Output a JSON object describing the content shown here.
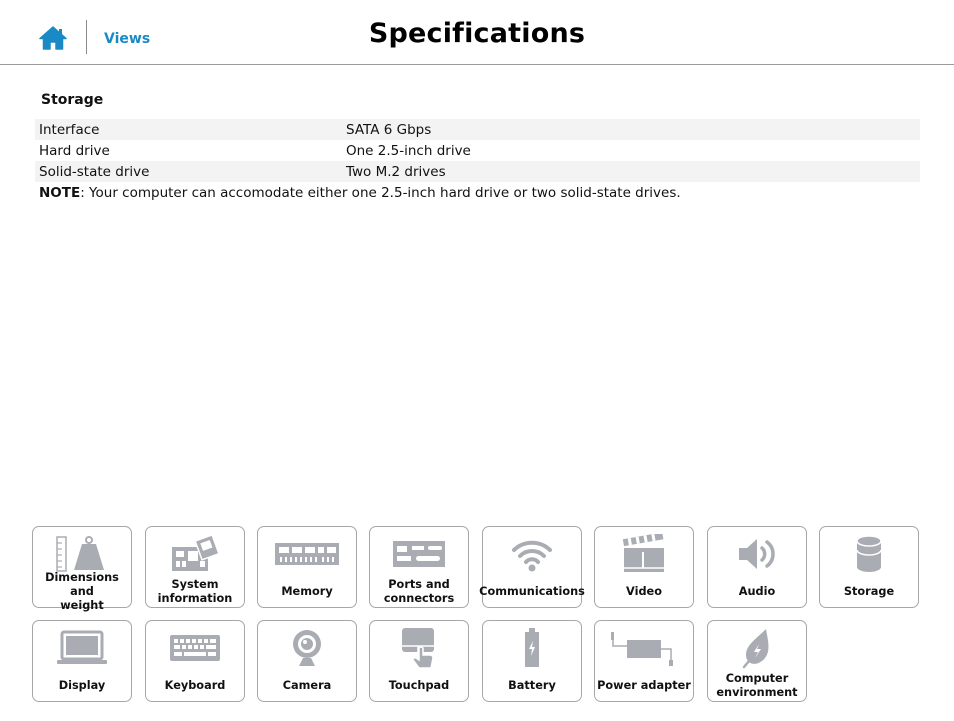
{
  "header": {
    "home_icon": "home-icon",
    "views_label": "Views",
    "title": "Specifications"
  },
  "section": {
    "title": "Storage",
    "rows": [
      {
        "label": "Interface",
        "value": "SATA 6 Gbps"
      },
      {
        "label": "Hard drive",
        "value": "One 2.5-inch drive"
      },
      {
        "label": "Solid-state drive",
        "value": "Two M.2 drives"
      }
    ],
    "note_bold": "NOTE",
    "note_text": ": Your computer can accomodate either one 2.5-inch hard drive or two solid-state drives."
  },
  "tiles": [
    {
      "line1": "Dimensions and",
      "line2": "weight",
      "icon": "ruler-weight-icon"
    },
    {
      "line1": "System",
      "line2": "information",
      "icon": "motherboard-icon"
    },
    {
      "line1": "Memory",
      "line2": "",
      "icon": "memory-icon"
    },
    {
      "line1": "Ports and",
      "line2": "connectors",
      "icon": "ports-icon"
    },
    {
      "line1": "Communications",
      "line2": "",
      "icon": "wifi-icon"
    },
    {
      "line1": "Video",
      "line2": "",
      "icon": "video-icon"
    },
    {
      "line1": "Audio",
      "line2": "",
      "icon": "speaker-icon"
    },
    {
      "line1": "Storage",
      "line2": "",
      "icon": "storage-icon"
    },
    {
      "line1": "Display",
      "line2": "",
      "icon": "display-icon"
    },
    {
      "line1": "Keyboard",
      "line2": "",
      "icon": "keyboard-icon"
    },
    {
      "line1": "Camera",
      "line2": "",
      "icon": "camera-icon"
    },
    {
      "line1": "Touchpad",
      "line2": "",
      "icon": "touchpad-icon"
    },
    {
      "line1": "Battery",
      "line2": "",
      "icon": "battery-icon"
    },
    {
      "line1": "Power adapter",
      "line2": "",
      "icon": "power-adapter-icon"
    },
    {
      "line1": "Computer",
      "line2": "environment",
      "icon": "leaf-icon"
    }
  ],
  "colors": {
    "accent": "#1a8ac6",
    "icon_gray": "#a9adb3",
    "border": "#a7a7a7"
  }
}
